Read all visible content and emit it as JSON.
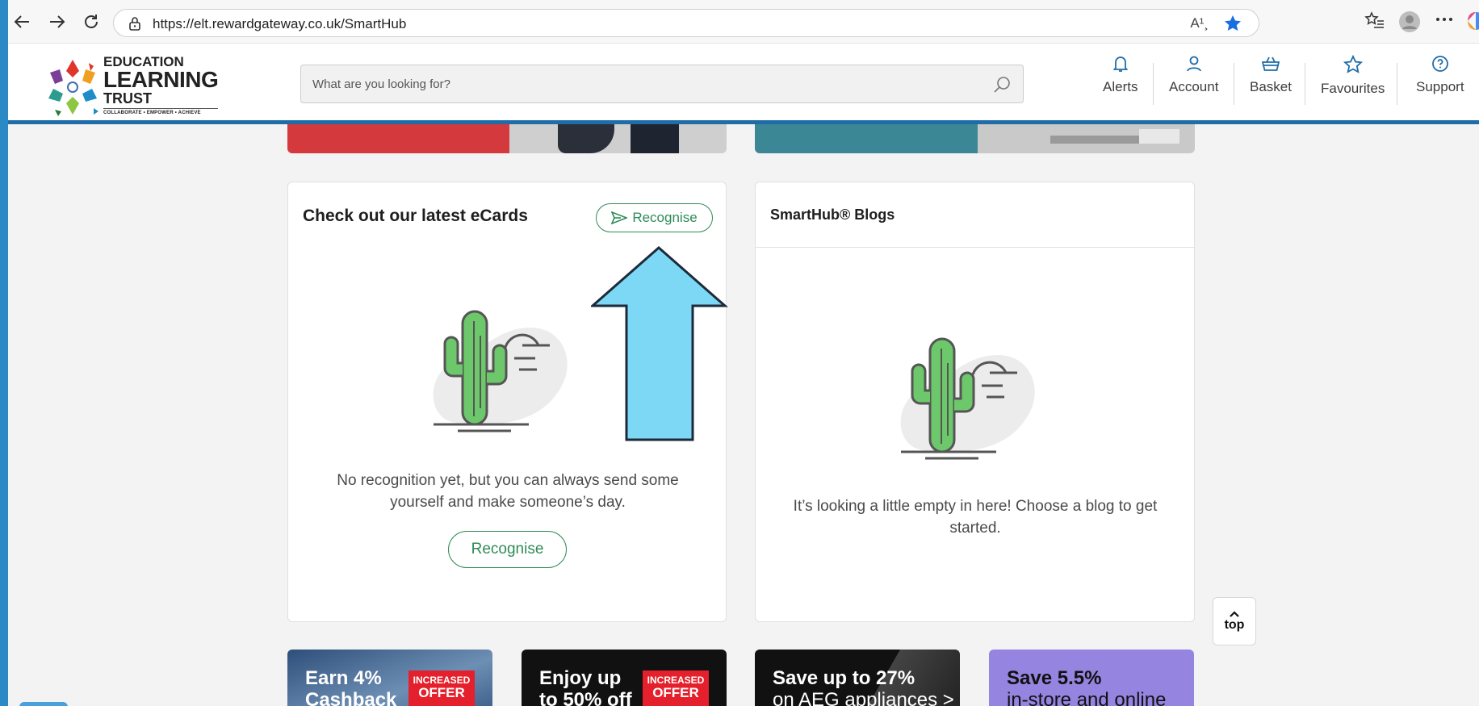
{
  "browser": {
    "url": "https://elt.rewardgateway.co.uk/SmartHub",
    "read_aloud": "A¹¸"
  },
  "logo": {
    "line1": "EDUCATION",
    "line2": "LEARNING",
    "line3": "TRUST",
    "tagline": "COLLABORATE • EMPOWER • ACHIEVE"
  },
  "search": {
    "placeholder": "What are you looking for?"
  },
  "nav": {
    "alerts": "Alerts",
    "account": "Account",
    "basket": "Basket",
    "favourites": "Favourites",
    "support": "Support"
  },
  "ecards": {
    "title": "Check out our latest eCards",
    "header_button": "Recognise",
    "message": "No recognition yet, but you can always send some yourself and make someone’s day.",
    "button": "Recognise"
  },
  "blogs": {
    "title": "SmartHub® Blogs",
    "message": "It’s looking a little empty in here! Choose a blog to get started."
  },
  "back_to_top": "top",
  "promos": [
    {
      "text_1": "Earn 4%",
      "text_2": "Cashback",
      "badge_1": "INCREASED",
      "badge_2": "OFFER"
    },
    {
      "text_1": "Enjoy up",
      "text_2": "to 50% off",
      "badge_1": "INCREASED",
      "badge_2": "OFFER"
    },
    {
      "text_1": "Save up to 27%",
      "text_2": "on AEG appliances >"
    },
    {
      "text_1": "Save 5.5%",
      "text_2": "in-store and online"
    }
  ],
  "colors": {
    "accent_green": "#2f8b57",
    "header_rule": "#1f6da8",
    "annotation_arrow": "#7dd8f5"
  }
}
